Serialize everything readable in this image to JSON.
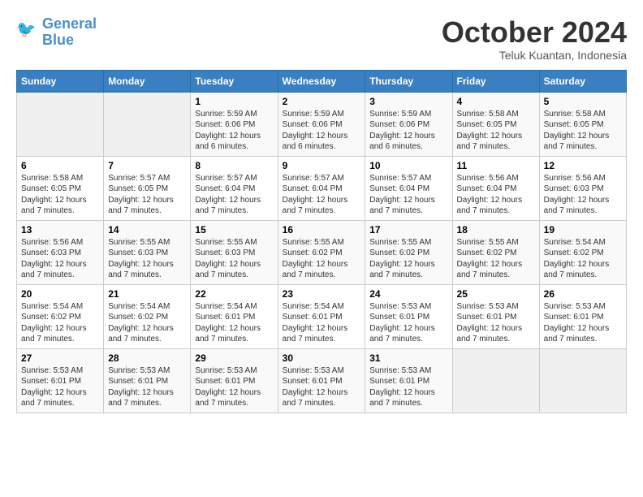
{
  "logo": {
    "line1": "General",
    "line2": "Blue"
  },
  "title": "October 2024",
  "subtitle": "Teluk Kuantan, Indonesia",
  "headers": [
    "Sunday",
    "Monday",
    "Tuesday",
    "Wednesday",
    "Thursday",
    "Friday",
    "Saturday"
  ],
  "weeks": [
    [
      {
        "day": "",
        "detail": ""
      },
      {
        "day": "",
        "detail": ""
      },
      {
        "day": "1",
        "detail": "Sunrise: 5:59 AM\nSunset: 6:06 PM\nDaylight: 12 hours\nand 6 minutes."
      },
      {
        "day": "2",
        "detail": "Sunrise: 5:59 AM\nSunset: 6:06 PM\nDaylight: 12 hours\nand 6 minutes."
      },
      {
        "day": "3",
        "detail": "Sunrise: 5:59 AM\nSunset: 6:06 PM\nDaylight: 12 hours\nand 6 minutes."
      },
      {
        "day": "4",
        "detail": "Sunrise: 5:58 AM\nSunset: 6:05 PM\nDaylight: 12 hours\nand 7 minutes."
      },
      {
        "day": "5",
        "detail": "Sunrise: 5:58 AM\nSunset: 6:05 PM\nDaylight: 12 hours\nand 7 minutes."
      }
    ],
    [
      {
        "day": "6",
        "detail": "Sunrise: 5:58 AM\nSunset: 6:05 PM\nDaylight: 12 hours\nand 7 minutes."
      },
      {
        "day": "7",
        "detail": "Sunrise: 5:57 AM\nSunset: 6:05 PM\nDaylight: 12 hours\nand 7 minutes."
      },
      {
        "day": "8",
        "detail": "Sunrise: 5:57 AM\nSunset: 6:04 PM\nDaylight: 12 hours\nand 7 minutes."
      },
      {
        "day": "9",
        "detail": "Sunrise: 5:57 AM\nSunset: 6:04 PM\nDaylight: 12 hours\nand 7 minutes."
      },
      {
        "day": "10",
        "detail": "Sunrise: 5:57 AM\nSunset: 6:04 PM\nDaylight: 12 hours\nand 7 minutes."
      },
      {
        "day": "11",
        "detail": "Sunrise: 5:56 AM\nSunset: 6:04 PM\nDaylight: 12 hours\nand 7 minutes."
      },
      {
        "day": "12",
        "detail": "Sunrise: 5:56 AM\nSunset: 6:03 PM\nDaylight: 12 hours\nand 7 minutes."
      }
    ],
    [
      {
        "day": "13",
        "detail": "Sunrise: 5:56 AM\nSunset: 6:03 PM\nDaylight: 12 hours\nand 7 minutes."
      },
      {
        "day": "14",
        "detail": "Sunrise: 5:55 AM\nSunset: 6:03 PM\nDaylight: 12 hours\nand 7 minutes."
      },
      {
        "day": "15",
        "detail": "Sunrise: 5:55 AM\nSunset: 6:03 PM\nDaylight: 12 hours\nand 7 minutes."
      },
      {
        "day": "16",
        "detail": "Sunrise: 5:55 AM\nSunset: 6:02 PM\nDaylight: 12 hours\nand 7 minutes."
      },
      {
        "day": "17",
        "detail": "Sunrise: 5:55 AM\nSunset: 6:02 PM\nDaylight: 12 hours\nand 7 minutes."
      },
      {
        "day": "18",
        "detail": "Sunrise: 5:55 AM\nSunset: 6:02 PM\nDaylight: 12 hours\nand 7 minutes."
      },
      {
        "day": "19",
        "detail": "Sunrise: 5:54 AM\nSunset: 6:02 PM\nDaylight: 12 hours\nand 7 minutes."
      }
    ],
    [
      {
        "day": "20",
        "detail": "Sunrise: 5:54 AM\nSunset: 6:02 PM\nDaylight: 12 hours\nand 7 minutes."
      },
      {
        "day": "21",
        "detail": "Sunrise: 5:54 AM\nSunset: 6:02 PM\nDaylight: 12 hours\nand 7 minutes."
      },
      {
        "day": "22",
        "detail": "Sunrise: 5:54 AM\nSunset: 6:01 PM\nDaylight: 12 hours\nand 7 minutes."
      },
      {
        "day": "23",
        "detail": "Sunrise: 5:54 AM\nSunset: 6:01 PM\nDaylight: 12 hours\nand 7 minutes."
      },
      {
        "day": "24",
        "detail": "Sunrise: 5:53 AM\nSunset: 6:01 PM\nDaylight: 12 hours\nand 7 minutes."
      },
      {
        "day": "25",
        "detail": "Sunrise: 5:53 AM\nSunset: 6:01 PM\nDaylight: 12 hours\nand 7 minutes."
      },
      {
        "day": "26",
        "detail": "Sunrise: 5:53 AM\nSunset: 6:01 PM\nDaylight: 12 hours\nand 7 minutes."
      }
    ],
    [
      {
        "day": "27",
        "detail": "Sunrise: 5:53 AM\nSunset: 6:01 PM\nDaylight: 12 hours\nand 7 minutes."
      },
      {
        "day": "28",
        "detail": "Sunrise: 5:53 AM\nSunset: 6:01 PM\nDaylight: 12 hours\nand 7 minutes."
      },
      {
        "day": "29",
        "detail": "Sunrise: 5:53 AM\nSunset: 6:01 PM\nDaylight: 12 hours\nand 7 minutes."
      },
      {
        "day": "30",
        "detail": "Sunrise: 5:53 AM\nSunset: 6:01 PM\nDaylight: 12 hours\nand 7 minutes."
      },
      {
        "day": "31",
        "detail": "Sunrise: 5:53 AM\nSunset: 6:01 PM\nDaylight: 12 hours\nand 7 minutes."
      },
      {
        "day": "",
        "detail": ""
      },
      {
        "day": "",
        "detail": ""
      }
    ]
  ]
}
